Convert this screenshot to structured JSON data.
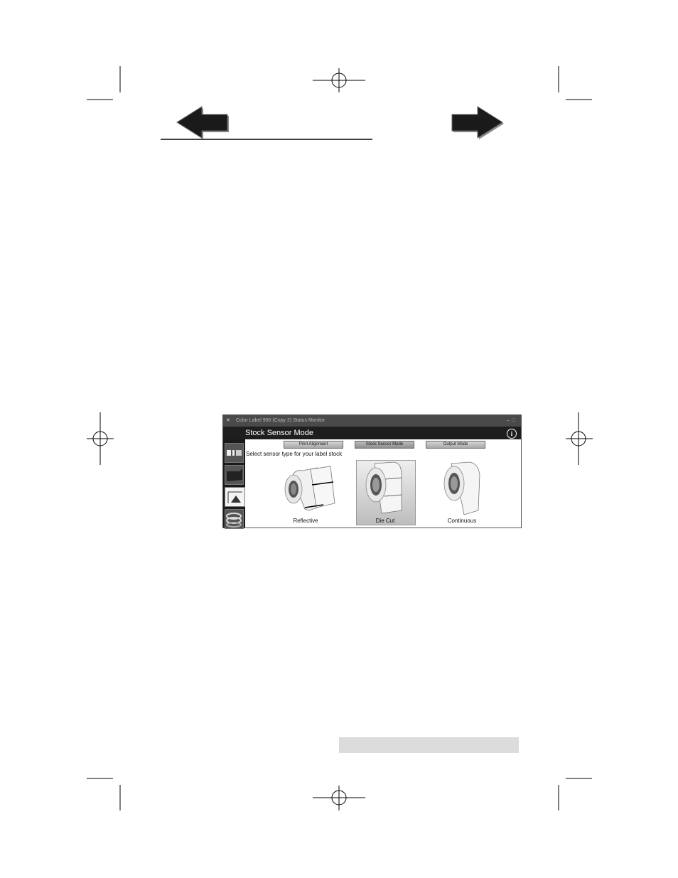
{
  "nav": {
    "back_icon": "left-arrow-icon",
    "forward_icon": "right-arrow-icon"
  },
  "screenshot": {
    "window_title": "Color Label 900 (Copy 2) Status Monitor",
    "header_title": "Stock Sensor Mode",
    "info_icon": "i",
    "tabs": [
      {
        "label": "Print Alignment",
        "selected": false
      },
      {
        "label": "Stock Sensor Mode",
        "selected": true
      },
      {
        "label": "Output Mode",
        "selected": false
      }
    ],
    "prompt": "Select sensor type for your label stock",
    "options": [
      {
        "label": "Reflective",
        "selected": false
      },
      {
        "label": "Die Cut",
        "selected": true
      },
      {
        "label": "Continuous",
        "selected": false
      }
    ],
    "sidebar_icons": [
      "print-alignment-icon",
      "printer-icon",
      "sensor-mode-icon",
      "label-roll-icon"
    ]
  },
  "colors": {
    "arrow_fill": "#1a1a1a",
    "window_dark": "#1e1e1e",
    "footer_bar": "#dcdcdc"
  }
}
